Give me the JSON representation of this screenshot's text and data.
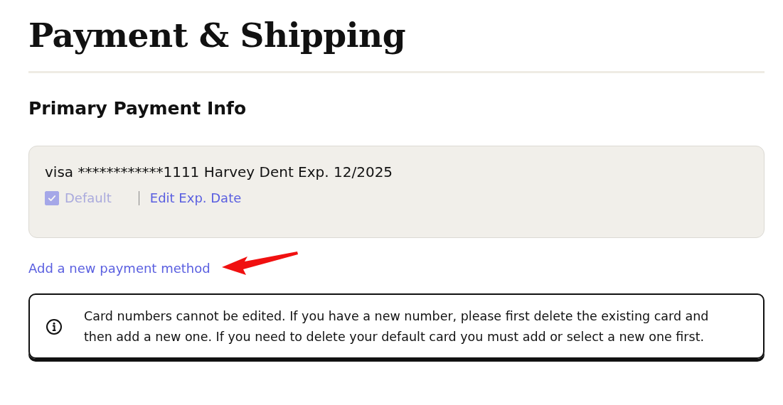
{
  "title": "Payment & Shipping",
  "section_title": "Primary Payment Info",
  "card": {
    "summary": "visa ************1111 Harvey Dent Exp. 12/2025",
    "default_checkbox": {
      "label": "Default",
      "checked": true,
      "disabled": true
    },
    "edit_link": "Edit Exp. Date"
  },
  "add_link": "Add a new payment method",
  "notice": {
    "text": "Card numbers cannot be edited. If you have a new number, please first delete the existing card and then add a new one. If you need to delete your default card you must add or select a new one first."
  }
}
